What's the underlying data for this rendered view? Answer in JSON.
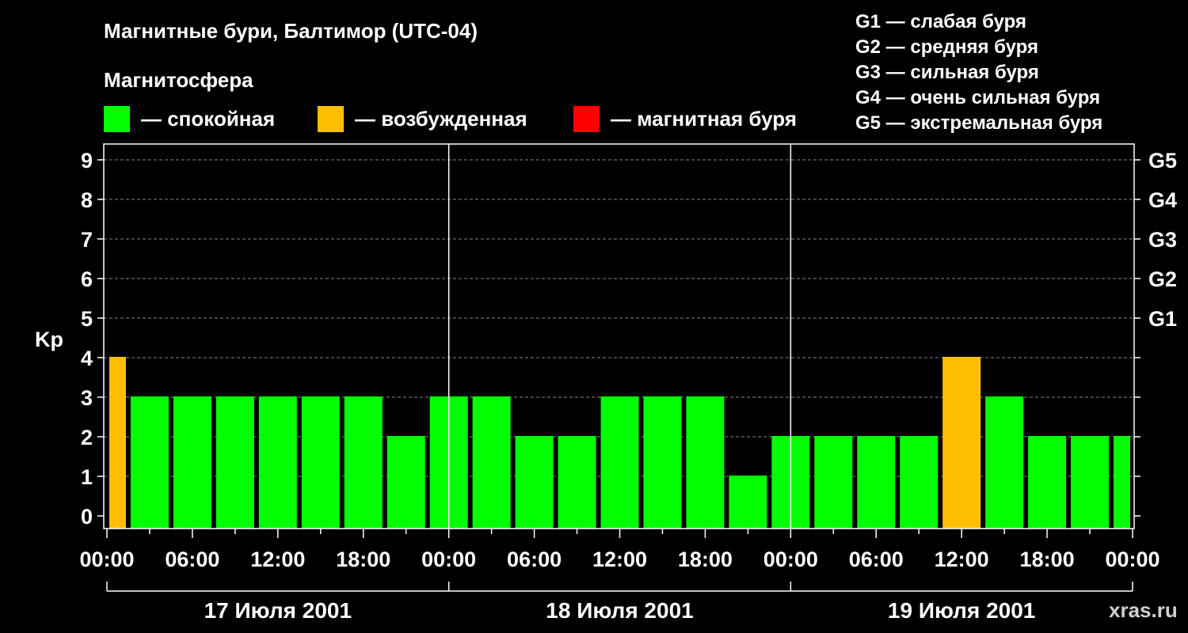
{
  "title": "Магнитные бури, Балтимор (UTC-04)",
  "legend": {
    "heading": "Магнитосфера",
    "items": [
      {
        "label": "— спокойная",
        "color": "#00ff00"
      },
      {
        "label": "— возбужденная",
        "color": "#ffbf00"
      },
      {
        "label": "— магнитная буря",
        "color": "#ff0000"
      }
    ]
  },
  "g_scale": [
    "G1 — слабая буря",
    "G2 — средняя буря",
    "G3 — сильная буря",
    "G4 — очень сильная буря",
    "G5 — экстремальная буря"
  ],
  "watermark": "xras.ru",
  "chart_data": {
    "type": "bar",
    "ylabel": "Kp",
    "ylim": [
      0,
      9
    ],
    "y_ticks": [
      0,
      1,
      2,
      3,
      4,
      5,
      6,
      7,
      8,
      9
    ],
    "right_ticks": [
      {
        "value": 5,
        "label": "G1"
      },
      {
        "value": 6,
        "label": "G2"
      },
      {
        "value": 7,
        "label": "G3"
      },
      {
        "value": 8,
        "label": "G4"
      },
      {
        "value": 9,
        "label": "G5"
      }
    ],
    "x_tick_labels": [
      "00:00",
      "06:00",
      "12:00",
      "18:00",
      "00:00",
      "06:00",
      "12:00",
      "18:00",
      "00:00",
      "06:00",
      "12:00",
      "18:00",
      "00:00"
    ],
    "days": [
      "17 Июля 2001",
      "18 Июля 2001",
      "19 Июля 2001"
    ],
    "x_range_hours": [
      0,
      72
    ],
    "bars": [
      {
        "start": 0,
        "end": 1.5,
        "value": 4
      },
      {
        "start": 1.5,
        "end": 4.5,
        "value": 3
      },
      {
        "start": 4.5,
        "end": 7.5,
        "value": 3
      },
      {
        "start": 7.5,
        "end": 10.5,
        "value": 3
      },
      {
        "start": 10.5,
        "end": 13.5,
        "value": 3
      },
      {
        "start": 13.5,
        "end": 16.5,
        "value": 3
      },
      {
        "start": 16.5,
        "end": 19.5,
        "value": 3
      },
      {
        "start": 19.5,
        "end": 22.5,
        "value": 2
      },
      {
        "start": 22.5,
        "end": 25.5,
        "value": 3
      },
      {
        "start": 25.5,
        "end": 28.5,
        "value": 3
      },
      {
        "start": 28.5,
        "end": 31.5,
        "value": 2
      },
      {
        "start": 31.5,
        "end": 34.5,
        "value": 2
      },
      {
        "start": 34.5,
        "end": 37.5,
        "value": 3
      },
      {
        "start": 37.5,
        "end": 40.5,
        "value": 3
      },
      {
        "start": 40.5,
        "end": 43.5,
        "value": 3
      },
      {
        "start": 43.5,
        "end": 46.5,
        "value": 1
      },
      {
        "start": 46.5,
        "end": 49.5,
        "value": 2
      },
      {
        "start": 49.5,
        "end": 52.5,
        "value": 2
      },
      {
        "start": 52.5,
        "end": 55.5,
        "value": 2
      },
      {
        "start": 55.5,
        "end": 58.5,
        "value": 2
      },
      {
        "start": 58.5,
        "end": 61.5,
        "value": 4
      },
      {
        "start": 61.5,
        "end": 64.5,
        "value": 3
      },
      {
        "start": 64.5,
        "end": 67.5,
        "value": 2
      },
      {
        "start": 67.5,
        "end": 70.5,
        "value": 2
      },
      {
        "start": 70.5,
        "end": 72,
        "value": 2
      }
    ]
  }
}
